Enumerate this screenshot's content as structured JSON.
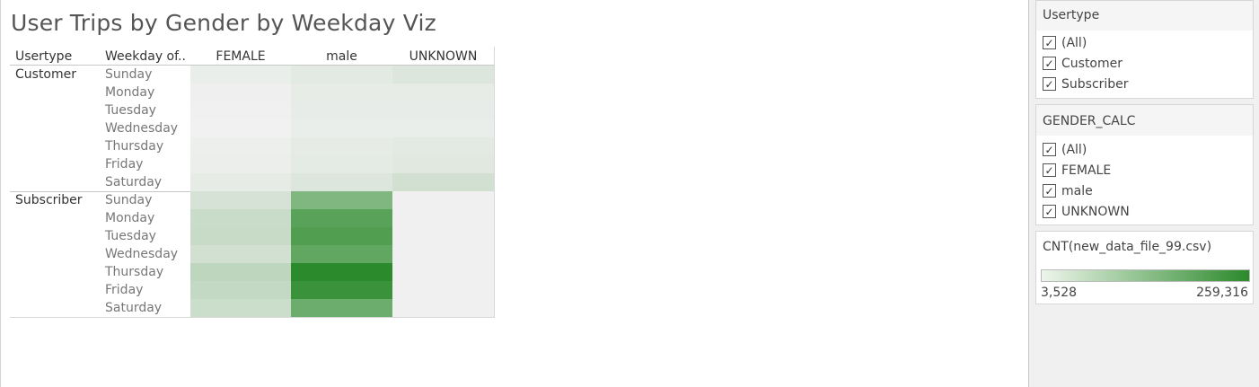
{
  "title": "User Trips by Gender by Weekday Viz",
  "table": {
    "row_header_1": "Usertype",
    "row_header_2": "Weekday of..",
    "columns": [
      "FEMALE",
      "male",
      "UNKNOWN"
    ]
  },
  "colors": {
    "low": "#f1f1f1",
    "high": "#2b8a2b",
    "empty": "#f0f0f0"
  },
  "chart_data": {
    "type": "heatmap",
    "title": "User Trips by Gender by Weekday Viz",
    "xlabel": "",
    "ylabel": "",
    "columns": [
      "FEMALE",
      "male",
      "UNKNOWN"
    ],
    "groups": [
      {
        "name": "Customer",
        "rows": [
          {
            "label": "Sunday",
            "values": [
              12000,
              22000,
              30000
            ]
          },
          {
            "label": "Monday",
            "values": [
              8000,
              17000,
              17000
            ]
          },
          {
            "label": "Tuesday",
            "values": [
              6000,
              15000,
              15000
            ]
          },
          {
            "label": "Wednesday",
            "values": [
              3528,
              12000,
              12000
            ]
          },
          {
            "label": "Thursday",
            "values": [
              9000,
              18000,
              22000
            ]
          },
          {
            "label": "Friday",
            "values": [
              10000,
              20000,
              26000
            ]
          },
          {
            "label": "Saturday",
            "values": [
              18000,
              30000,
              45000
            ]
          }
        ]
      },
      {
        "name": "Subscriber",
        "rows": [
          {
            "label": "Sunday",
            "values": [
              40000,
              150000,
              null
            ]
          },
          {
            "label": "Monday",
            "values": [
              55000,
              200000,
              null
            ]
          },
          {
            "label": "Tuesday",
            "values": [
              58000,
              210000,
              null
            ]
          },
          {
            "label": "Wednesday",
            "values": [
              45000,
              190000,
              null
            ]
          },
          {
            "label": "Thursday",
            "values": [
              70000,
              259316,
              null
            ]
          },
          {
            "label": "Friday",
            "values": [
              62000,
              240000,
              null
            ]
          },
          {
            "label": "Saturday",
            "values": [
              52000,
              175000,
              null
            ]
          }
        ]
      }
    ],
    "color_range": [
      3528,
      259316
    ]
  },
  "filters": {
    "usertype": {
      "title": "Usertype",
      "options": [
        "(All)",
        "Customer",
        "Subscriber"
      ]
    },
    "gender": {
      "title": "GENDER_CALC",
      "options": [
        "(All)",
        "FEMALE",
        "male",
        "UNKNOWN"
      ]
    },
    "check_glyph": "✓"
  },
  "legend": {
    "title": "CNT(new_data_file_99.csv)",
    "min_label": "3,528",
    "max_label": "259,316"
  }
}
